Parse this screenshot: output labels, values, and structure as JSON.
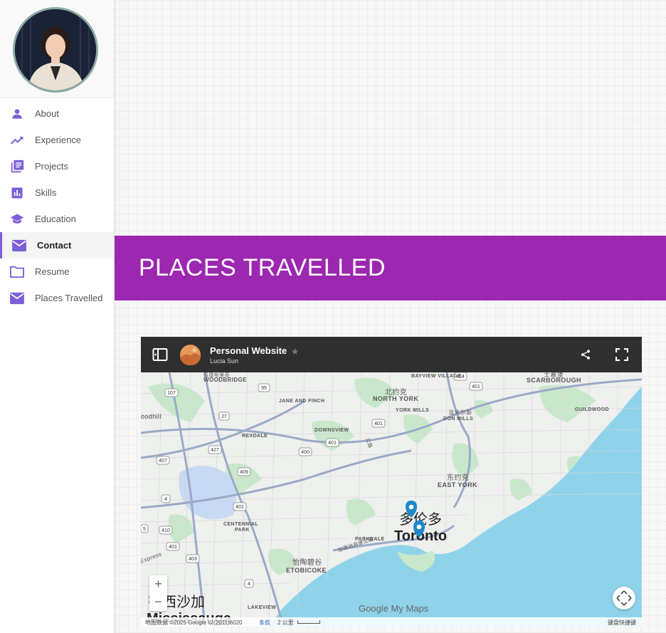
{
  "nav": {
    "items": [
      {
        "label": "About",
        "icon": "person-icon"
      },
      {
        "label": "Experience",
        "icon": "trending-up-icon"
      },
      {
        "label": "Projects",
        "icon": "library-books-icon"
      },
      {
        "label": "Skills",
        "icon": "bar-chart-icon"
      },
      {
        "label": "Education",
        "icon": "school-icon"
      },
      {
        "label": "Contact",
        "icon": "mail-icon",
        "active": true
      },
      {
        "label": "Resume",
        "icon": "folder-icon"
      },
      {
        "label": "Places Travelled",
        "icon": "mail-icon"
      }
    ]
  },
  "colors": {
    "accent": "#7b5fd8",
    "banner": "#9c27b0",
    "map_header": "#2f2f2f",
    "water": "#8fd3ea"
  },
  "section": {
    "title": "PLACES TRAVELLED"
  },
  "map": {
    "title": "Personal Website",
    "owner": "Lucia Sun",
    "zoom_in": "+",
    "zoom_out": "−",
    "brand": "Google My Maps",
    "attribution": "地图数据 ©2025 Google 以(2011)6020",
    "terms": "条款",
    "scale": "2 公里",
    "keyboard": "键盘快捷键",
    "labels": {
      "woodbridge": "WOODBRIDGE",
      "woodbridge_cn": "伍德布里奇",
      "village": "BAYVIEW VILLAGE",
      "scarborough_cn": "士嘉堡",
      "scarborough": "SCARBOROUGH",
      "north_york_cn": "北约克",
      "north_york": "NORTH YORK",
      "jane_finch": "JANE AND FINCH",
      "york_mills": "YORK MILLS",
      "don_mills_cn": "当米尔斯",
      "don_mills": "DON MILLS",
      "guildwood": "GUILDWOOD",
      "woodhill": "oodhill",
      "rexdale": "REXDALE",
      "downsview": "DOWNSVIEW",
      "east_york_cn": "东约克",
      "east_york": "EAST YORK",
      "toronto_cn": "多伦多",
      "toronto": "Toronto",
      "centennial": "CENTENNIAL",
      "park": "PARK",
      "parkdale": "PARKDALE",
      "etobicoke_cn": "怡陶碧谷",
      "etobicoke": "ETOBICOKE",
      "mississauga_cn": "密西沙加",
      "mississauga": "Mississauga",
      "lakeview": "LAKEVIEW",
      "expressway_cn": "加德纳高速公路",
      "express": "Express",
      "dvp_cn": "公路"
    },
    "shields": [
      "107",
      "95",
      "27",
      "427",
      "409",
      "401",
      "400",
      "401",
      "401",
      "404",
      "401",
      "407",
      "4",
      "410",
      "401",
      "403",
      "5",
      "4"
    ]
  }
}
